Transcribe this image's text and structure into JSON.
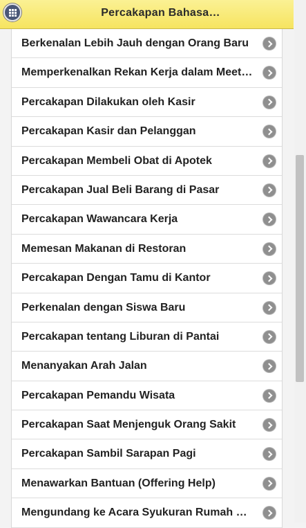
{
  "header": {
    "title": "Percakapan Bahasa…",
    "menu_icon": "grid-menu-icon"
  },
  "items": [
    {
      "label": "Berkenalan Lebih Jauh dengan Orang Baru"
    },
    {
      "label": "Memperkenalkan Rekan Kerja dalam Meeting"
    },
    {
      "label": "Percakapan Dilakukan oleh Kasir"
    },
    {
      "label": "Percakapan Kasir dan Pelanggan"
    },
    {
      "label": "Percakapan Membeli Obat di Apotek"
    },
    {
      "label": "Percakapan Jual Beli Barang di Pasar"
    },
    {
      "label": "Percakapan Wawancara Kerja"
    },
    {
      "label": "Memesan Makanan di Restoran"
    },
    {
      "label": "Percakapan Dengan Tamu di Kantor"
    },
    {
      "label": "Perkenalan dengan Siswa Baru"
    },
    {
      "label": "Percakapan tentang Liburan di Pantai"
    },
    {
      "label": "Menanyakan Arah Jalan"
    },
    {
      "label": "Percakapan Pemandu Wisata"
    },
    {
      "label": "Percakapan Saat Menjenguk Orang Sakit"
    },
    {
      "label": "Percakapan Sambil Sarapan Pagi"
    },
    {
      "label": "Menawarkan Bantuan (Offering Help)"
    },
    {
      "label": "Mengundang ke Acara Syukuran Rumah Baru"
    }
  ],
  "colors": {
    "header_bg": "#f6e460",
    "menu_button_bg": "#4a5777",
    "chevron_bg": "#8f8f8f"
  }
}
